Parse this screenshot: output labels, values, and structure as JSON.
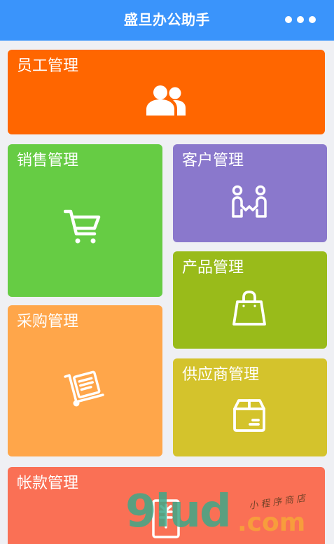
{
  "header": {
    "title": "盛旦办公助手",
    "menu_icon": "more-dots-icon",
    "background": "#3a94fb"
  },
  "tiles": [
    {
      "label": "员工管理",
      "icon": "users-icon",
      "color": "#ff6600"
    },
    {
      "label": "销售管理",
      "icon": "shopping-cart-icon",
      "color": "#66cc44"
    },
    {
      "label": "客户管理",
      "icon": "handshake-people-icon",
      "color": "#8a78cc"
    },
    {
      "label": "产品管理",
      "icon": "shopping-bag-icon",
      "color": "#99bb1a"
    },
    {
      "label": "采购管理",
      "icon": "hand-truck-icon",
      "color": "#ffa64a"
    },
    {
      "label": "供应商管理",
      "icon": "package-box-icon",
      "color": "#d4c32c"
    },
    {
      "label": "帐款管理",
      "icon": "invoice-icon",
      "color": "#fa7055"
    }
  ],
  "watermark": {
    "main": "9lud",
    "domain": ".com",
    "tagline": "小程序商店"
  }
}
